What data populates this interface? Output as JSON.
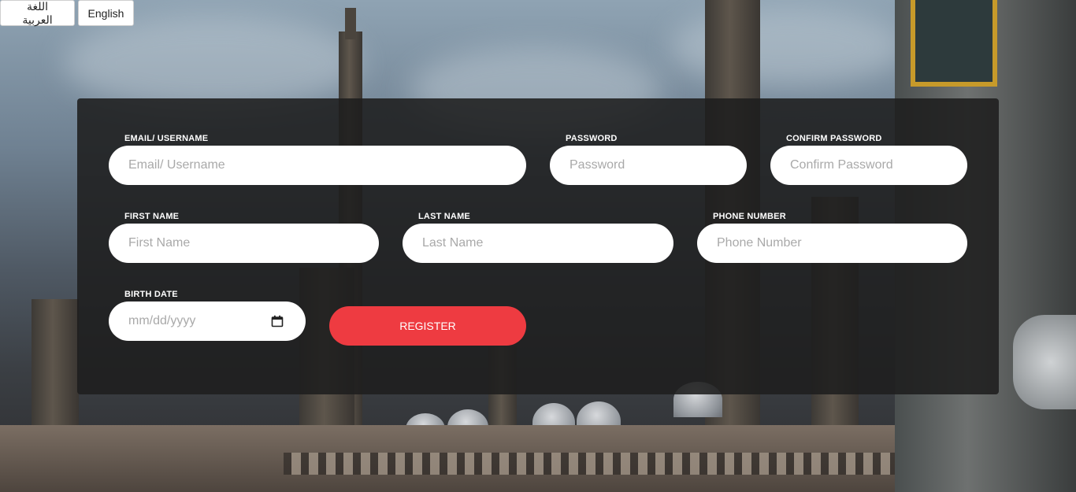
{
  "language_bar": {
    "arabic_label": "اللغة العربية",
    "english_label": "English"
  },
  "form": {
    "email": {
      "label": "EMAIL/ USERNAME",
      "placeholder": "Email/ Username"
    },
    "password": {
      "label": "PASSWORD",
      "placeholder": "Password"
    },
    "confirm_password": {
      "label": "CONFIRM PASSWORD",
      "placeholder": "Confirm Password"
    },
    "first_name": {
      "label": "FIRST NAME",
      "placeholder": "First Name"
    },
    "last_name": {
      "label": "LAST NAME",
      "placeholder": "Last Name"
    },
    "phone": {
      "label": "PHONE NUMBER",
      "placeholder": "Phone Number"
    },
    "birth_date": {
      "label": "BIRTH DATE",
      "placeholder": "mm/dd/yyyy",
      "icon": "calendar-icon"
    },
    "register_label": "REGISTER"
  },
  "colors": {
    "register_button": "#ee3b41",
    "panel_background": "rgba(30,30,30,0.88)",
    "input_background": "#ffffff"
  }
}
